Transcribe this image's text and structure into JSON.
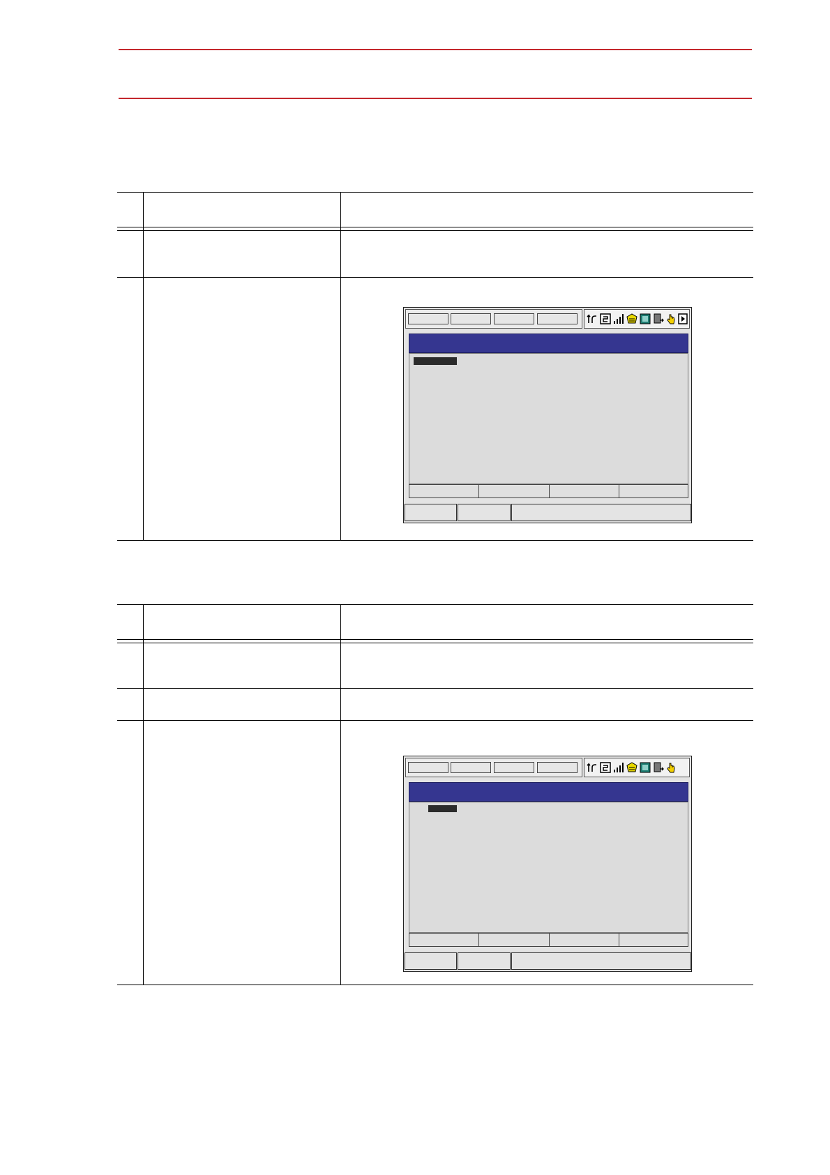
{
  "header": {
    "rule_color": "#c4282d",
    "title": ""
  },
  "table1": {
    "header": {
      "step": "",
      "operation": "",
      "explanation": ""
    },
    "rows": [
      {
        "step": "",
        "operation": "",
        "explanation": ""
      },
      {
        "step": "",
        "operation": "",
        "explanation": ""
      }
    ]
  },
  "table2": {
    "header": {
      "step": "",
      "operation": "",
      "explanation": ""
    },
    "rows": [
      {
        "step": "",
        "operation": "",
        "explanation": ""
      },
      {
        "step": "",
        "operation": "",
        "explanation": ""
      },
      {
        "step": "",
        "operation": "",
        "explanation": ""
      }
    ]
  },
  "screen1": {
    "icons": [
      "axis-group-icon",
      "coordinate-icon",
      "speed-icon",
      "security-icon",
      "play-mode-icon",
      "storage-icon",
      "hand-icon",
      "page-icon"
    ],
    "title_bar_color": "#353690"
  },
  "screen2": {
    "icons": [
      "axis-group-icon",
      "coordinate-icon",
      "speed-icon",
      "security-icon",
      "play-mode-icon",
      "storage-icon",
      "hand-icon"
    ],
    "title_bar_color": "#353690"
  }
}
